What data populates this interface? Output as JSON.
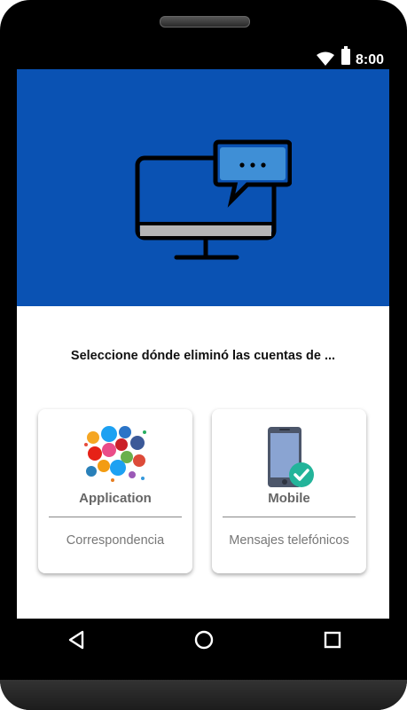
{
  "status_bar": {
    "time": "8:00",
    "icons": [
      "wifi-icon",
      "battery-icon"
    ]
  },
  "hero": {
    "icon": "monitor-chat-icon",
    "background_color": "#0a52b3"
  },
  "prompt": "Seleccione dónde eliminó las cuentas de ...",
  "options": [
    {
      "title": "Application",
      "subtitle": "Correspondencia",
      "icon": "social-apps-icon"
    },
    {
      "title": "Mobile",
      "subtitle": "Mensajes telefónicos",
      "icon": "phone-check-icon"
    }
  ],
  "navigation": {
    "buttons": [
      "back-icon",
      "home-icon",
      "recents-icon"
    ]
  }
}
